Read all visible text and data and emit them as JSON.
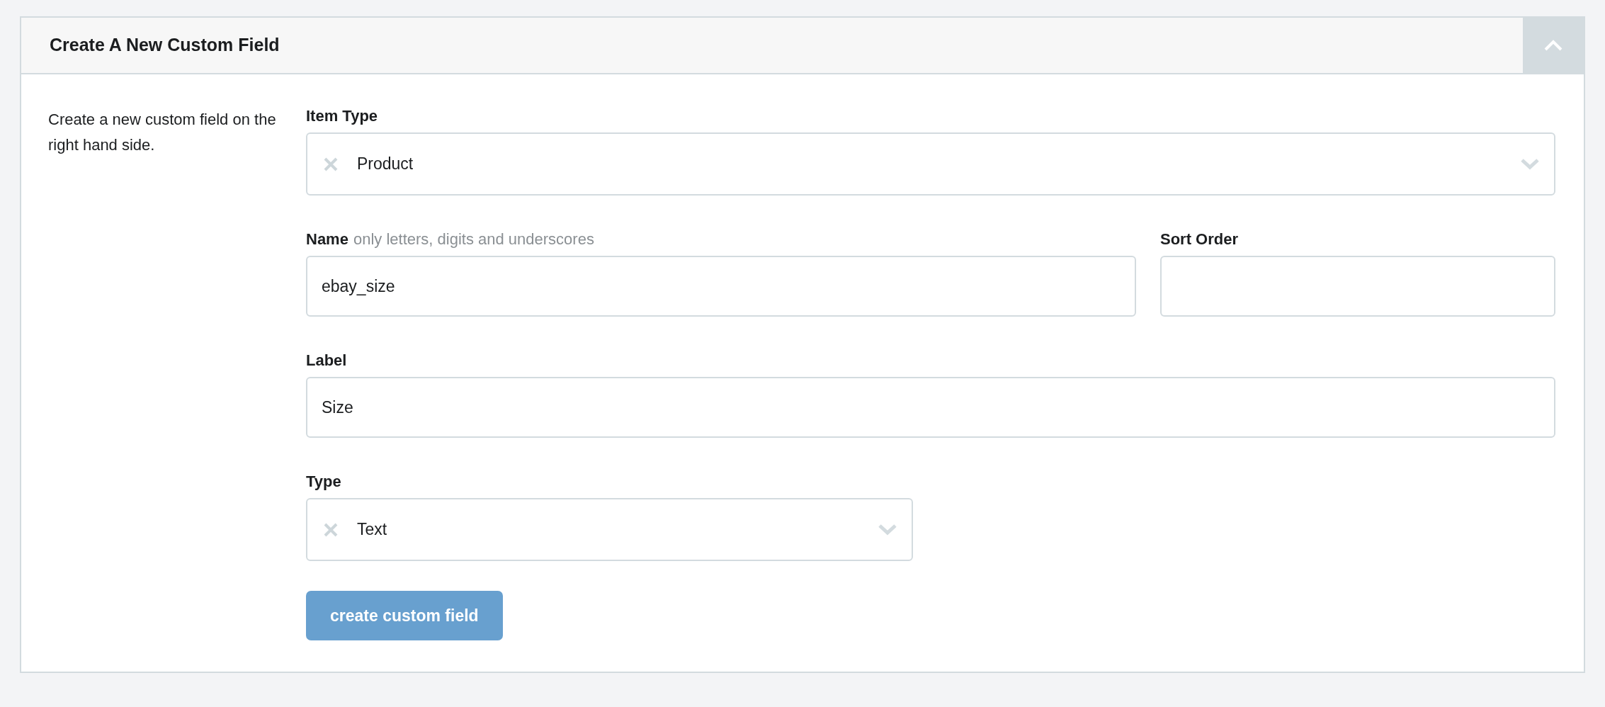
{
  "panel": {
    "title": "Create A New Custom Field",
    "expanded": true
  },
  "description": "Create a new custom field on the right hand side.",
  "rows": [
    {
      "fields": [
        {
          "kind": "select",
          "label": "Item Type",
          "value": "Product"
        }
      ]
    },
    {
      "fields": [
        {
          "kind": "input",
          "label": "Name",
          "hint": "only letters, digits and underscores",
          "value": "ebay_size"
        },
        {
          "kind": "input",
          "label": "Sort Order"
        }
      ]
    },
    {
      "fields": [
        {
          "kind": "input",
          "label": "Label",
          "value": "Size"
        }
      ]
    },
    {
      "fields": [
        {
          "kind": "select",
          "label": "Type",
          "value": "Text"
        }
      ]
    }
  ],
  "submit": {
    "label": "create custom field"
  }
}
